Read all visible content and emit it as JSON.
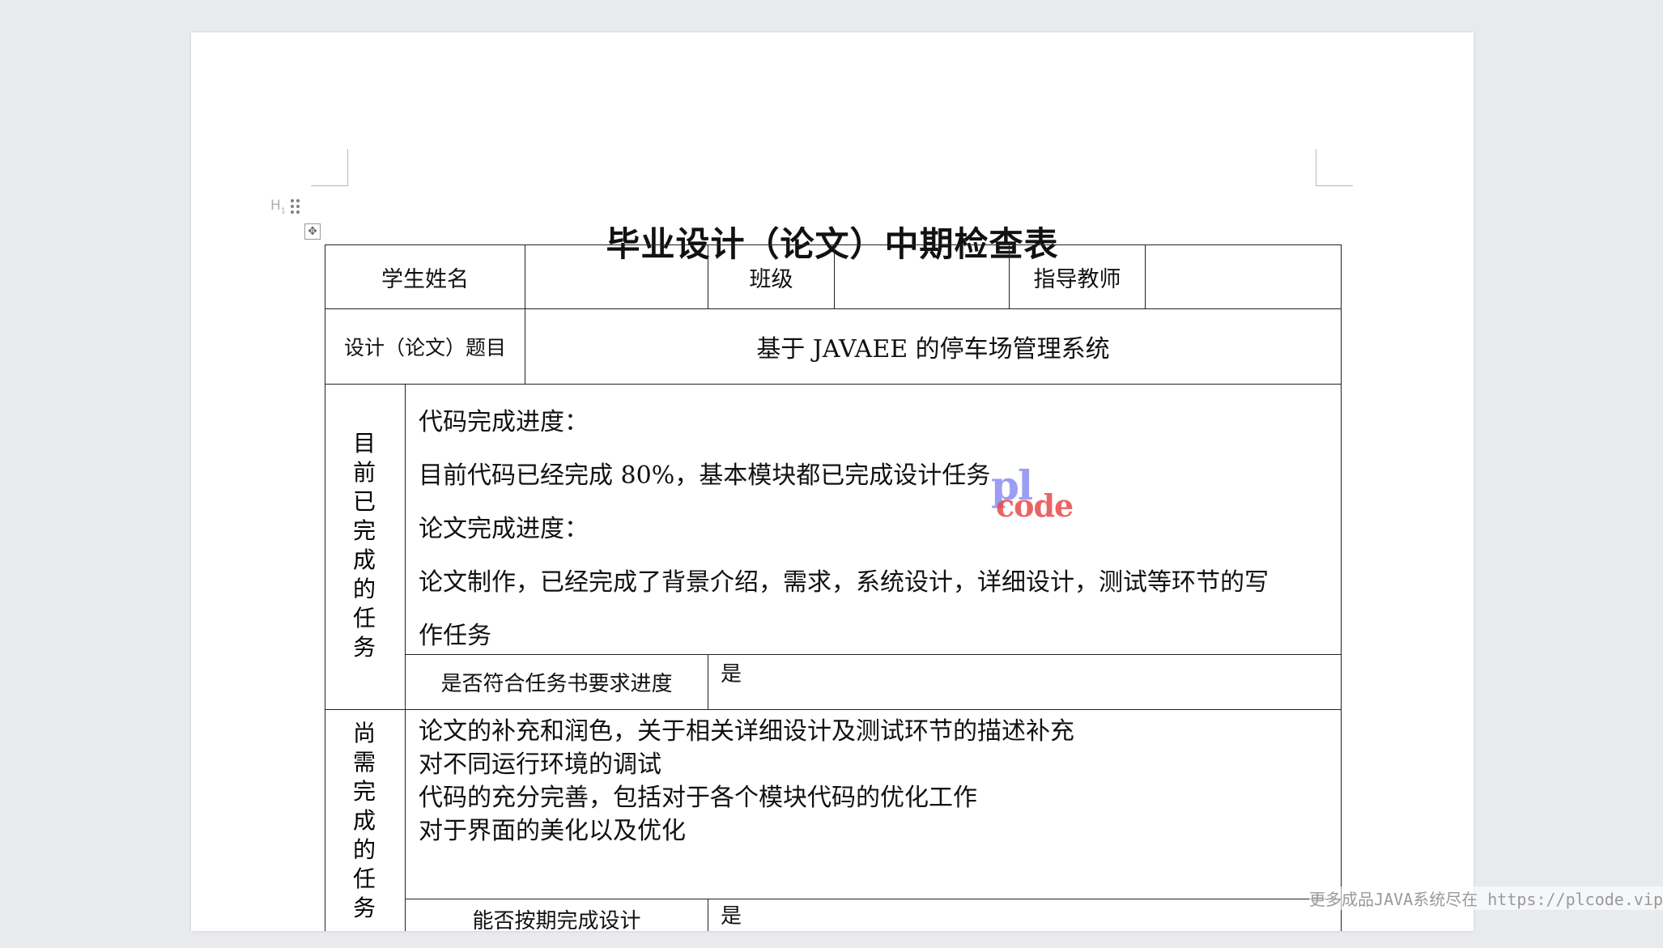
{
  "document": {
    "heading_marker": "H",
    "heading_marker_sub": "1",
    "title": "毕业设计（论文）中期检查表"
  },
  "form": {
    "student_name_label": "学生姓名",
    "student_name_value": "",
    "class_label": "班级",
    "class_value": "",
    "advisor_label": "指导教师",
    "advisor_value": "",
    "topic_label": "设计（论文）题目",
    "topic_value": "基于 JAVAEE 的停车场管理系统",
    "completed_section_label": [
      "目",
      "前",
      "已",
      "完",
      "成",
      "的",
      "任",
      "务"
    ],
    "completed_lines": [
      "代码完成进度：",
      "目前代码已经完成 80%，基本模块都已完成设计任务",
      "论文完成进度：",
      "论文制作，已经完成了背景介绍，需求，系统设计，详细设计，测试等环节的写",
      "作任务"
    ],
    "meets_schedule_label": "是否符合任务书要求进度",
    "meets_schedule_value": "是",
    "remaining_section_label": [
      "尚",
      "需",
      "完",
      "成",
      "的",
      "任",
      "务"
    ],
    "remaining_lines": [
      "论文的补充和润色，关于相关详细设计及测试环节的描述补充",
      "对不同运行环境的调试",
      "代码的充分完善，包括对于各个模块代码的优化工作",
      "对于界面的美化以及优化"
    ],
    "on_time_label": "能否按期完成设计",
    "on_time_value": "是"
  },
  "watermark": {
    "line1": "pl",
    "line2": "code"
  },
  "footer": {
    "note": "更多成品JAVA系统尽在 https://plcode.vip"
  }
}
